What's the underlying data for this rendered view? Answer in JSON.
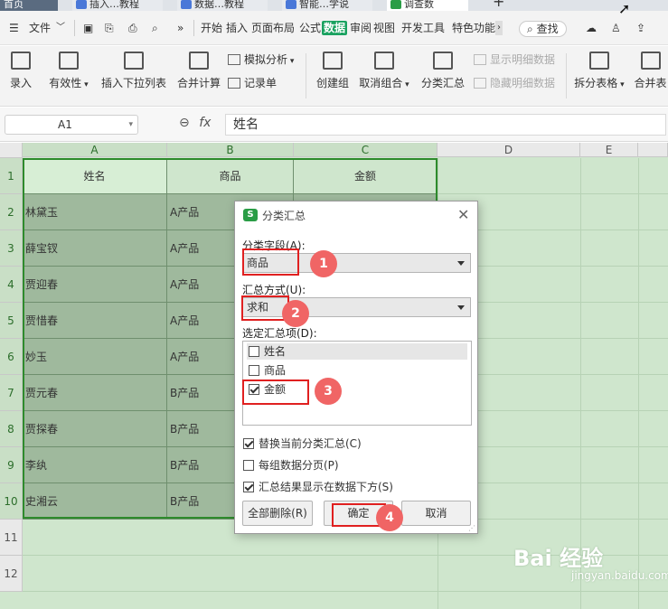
{
  "tabs": [
    {
      "label": "首页"
    },
    {
      "label": "插入…教程"
    },
    {
      "label": "数据…教程"
    },
    {
      "label": "智能…学说"
    },
    {
      "label": "调查数"
    }
  ],
  "menu": {
    "file": "文件",
    "items": [
      "开始",
      "插入",
      "页面布局",
      "公式",
      "数据",
      "审阅",
      "视图",
      "开发工具",
      "特色功能"
    ],
    "active": "数据",
    "search": "查找"
  },
  "ribbon": {
    "import": "录入",
    "validity": "有效性",
    "insert_dropdown": "插入下拉列表",
    "consolidate": "合并计算",
    "what_if": "模拟分析",
    "record": "记录单",
    "group": "创建组",
    "ungroup": "取消组合",
    "subtotal": "分类汇总",
    "show_detail": "显示明细数据",
    "hide_detail": "隐藏明细数据",
    "split_table": "拆分表格",
    "merge_table": "合并表"
  },
  "formula_bar": {
    "cell_ref": "A1",
    "fx": "fx",
    "content": "姓名"
  },
  "sheet": {
    "columns": [
      "A",
      "B",
      "C",
      "D",
      "E"
    ],
    "row_numbers": [
      "1",
      "2",
      "3",
      "4",
      "5",
      "6",
      "7",
      "8",
      "9",
      "10",
      "11",
      "12"
    ],
    "headers": [
      "姓名",
      "商品",
      "金额"
    ],
    "rows": [
      [
        "林黛玉",
        "A产品"
      ],
      [
        "薛宝钗",
        "A产品"
      ],
      [
        "贾迎春",
        "A产品"
      ],
      [
        "贾惜春",
        "A产品"
      ],
      [
        "妙玉",
        "A产品"
      ],
      [
        "贾元春",
        "B产品"
      ],
      [
        "贾探春",
        "B产品"
      ],
      [
        "李纨",
        "B产品"
      ],
      [
        "史湘云",
        "B产品"
      ]
    ]
  },
  "dialog": {
    "title": "分类汇总",
    "field_label": "分类字段(A):",
    "field_value": "商品",
    "method_label": "汇总方式(U):",
    "method_value": "求和",
    "items_label": "选定汇总项(D):",
    "items": [
      {
        "label": "姓名",
        "checked": false
      },
      {
        "label": "商品",
        "checked": false
      },
      {
        "label": "金额",
        "checked": true
      }
    ],
    "opt_replace": "替换当前分类汇总(C)",
    "opt_pagebreak": "每组数据分页(P)",
    "opt_below": "汇总结果显示在数据下方(S)",
    "btn_remove_all": "全部删除(R)",
    "btn_ok": "确定",
    "btn_cancel": "取消"
  },
  "annotations": [
    "1",
    "2",
    "3",
    "4"
  ],
  "watermark": {
    "main": "Bai 经验",
    "sub": "jingyan.baidu.com"
  },
  "colors": {
    "accent": "#1aa260",
    "selection": "#2e8b2c",
    "annotation": "#e02020",
    "badge": "#f06565"
  }
}
